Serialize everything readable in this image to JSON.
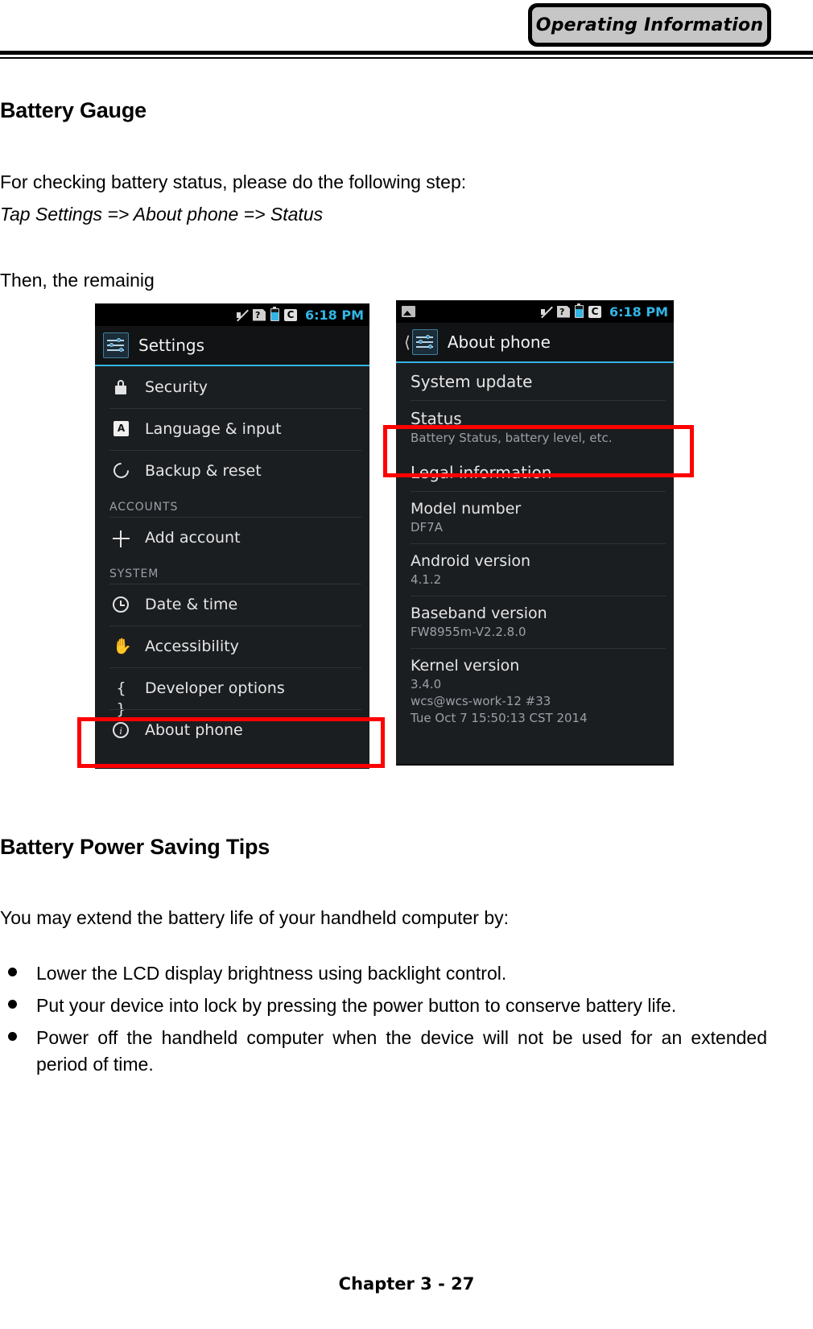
{
  "header": {
    "tab_label": "Operating Information"
  },
  "sections": [
    {
      "title": "Battery Gauge",
      "paragraphs": [
        "For checking battery status, please do the following step:",
        "Tap Settings => About phone => Status",
        "Then, the remainig"
      ]
    },
    {
      "title": "Battery Power Saving Tips",
      "intro": "You may extend the battery life of your handheld computer by:",
      "bullets": [
        "Lower the LCD display brightness using backlight control.",
        "Put your device into lock by pressing the power button to conserve battery life.",
        "Power off the handheld computer when the device will not be used for an extended period of time."
      ]
    }
  ],
  "screenshot_left": {
    "statusbar": {
      "time": "6:18 PM",
      "icons": [
        "mute-icon",
        "sim-card-icon",
        "battery-icon",
        "c-badge-icon"
      ]
    },
    "app_bar": {
      "title": "Settings",
      "icon": "settings-sliders-icon"
    },
    "rows": [
      {
        "type": "item",
        "label": "Security",
        "icon": "lock-icon"
      },
      {
        "type": "item",
        "label": "Language & input",
        "icon": "language-a-icon"
      },
      {
        "type": "item",
        "label": "Backup & reset",
        "icon": "backup-restore-icon"
      },
      {
        "type": "group",
        "label": "ACCOUNTS"
      },
      {
        "type": "item",
        "label": "Add account",
        "icon": "plus-icon"
      },
      {
        "type": "group",
        "label": "SYSTEM"
      },
      {
        "type": "item",
        "label": "Date & time",
        "icon": "clock-icon"
      },
      {
        "type": "item",
        "label": "Accessibility",
        "icon": "hand-icon"
      },
      {
        "type": "item",
        "label": "Developer options",
        "icon": "braces-icon"
      },
      {
        "type": "item",
        "label": "About phone",
        "icon": "info-circle-icon",
        "highlighted": true
      }
    ]
  },
  "screenshot_right": {
    "statusbar": {
      "time": "6:18 PM",
      "icons": [
        "image-icon",
        "mute-icon",
        "sim-card-icon",
        "battery-icon",
        "c-badge-icon"
      ]
    },
    "app_bar": {
      "title": "About phone",
      "icon": "settings-sliders-icon",
      "back": "back-chevron-icon"
    },
    "rows": [
      {
        "title": "System update",
        "sub": ""
      },
      {
        "title": "Status",
        "sub": "Battery Status, battery level, etc.",
        "highlighted": true
      },
      {
        "title": "Legal information",
        "sub": ""
      },
      {
        "title": "Model number",
        "sub": "DF7A"
      },
      {
        "title": "Android version",
        "sub": "4.1.2"
      },
      {
        "title": "Baseband version",
        "sub": "FW8955m-V2.2.8.0"
      },
      {
        "title": "Kernel version",
        "sub": "3.4.0"
      }
    ],
    "kernel_extra": [
      "wcs@wcs-work-12 #33",
      "Tue Oct 7 15:50:13 CST 2014"
    ]
  },
  "footer": {
    "page_label": "Chapter 3 - 27"
  },
  "colors": {
    "accent_blue": "#33b5e5",
    "highlight_red": "#ff0000",
    "header_tab_fill": "#c6c6c6",
    "phone_bg": "#1b1e21"
  }
}
